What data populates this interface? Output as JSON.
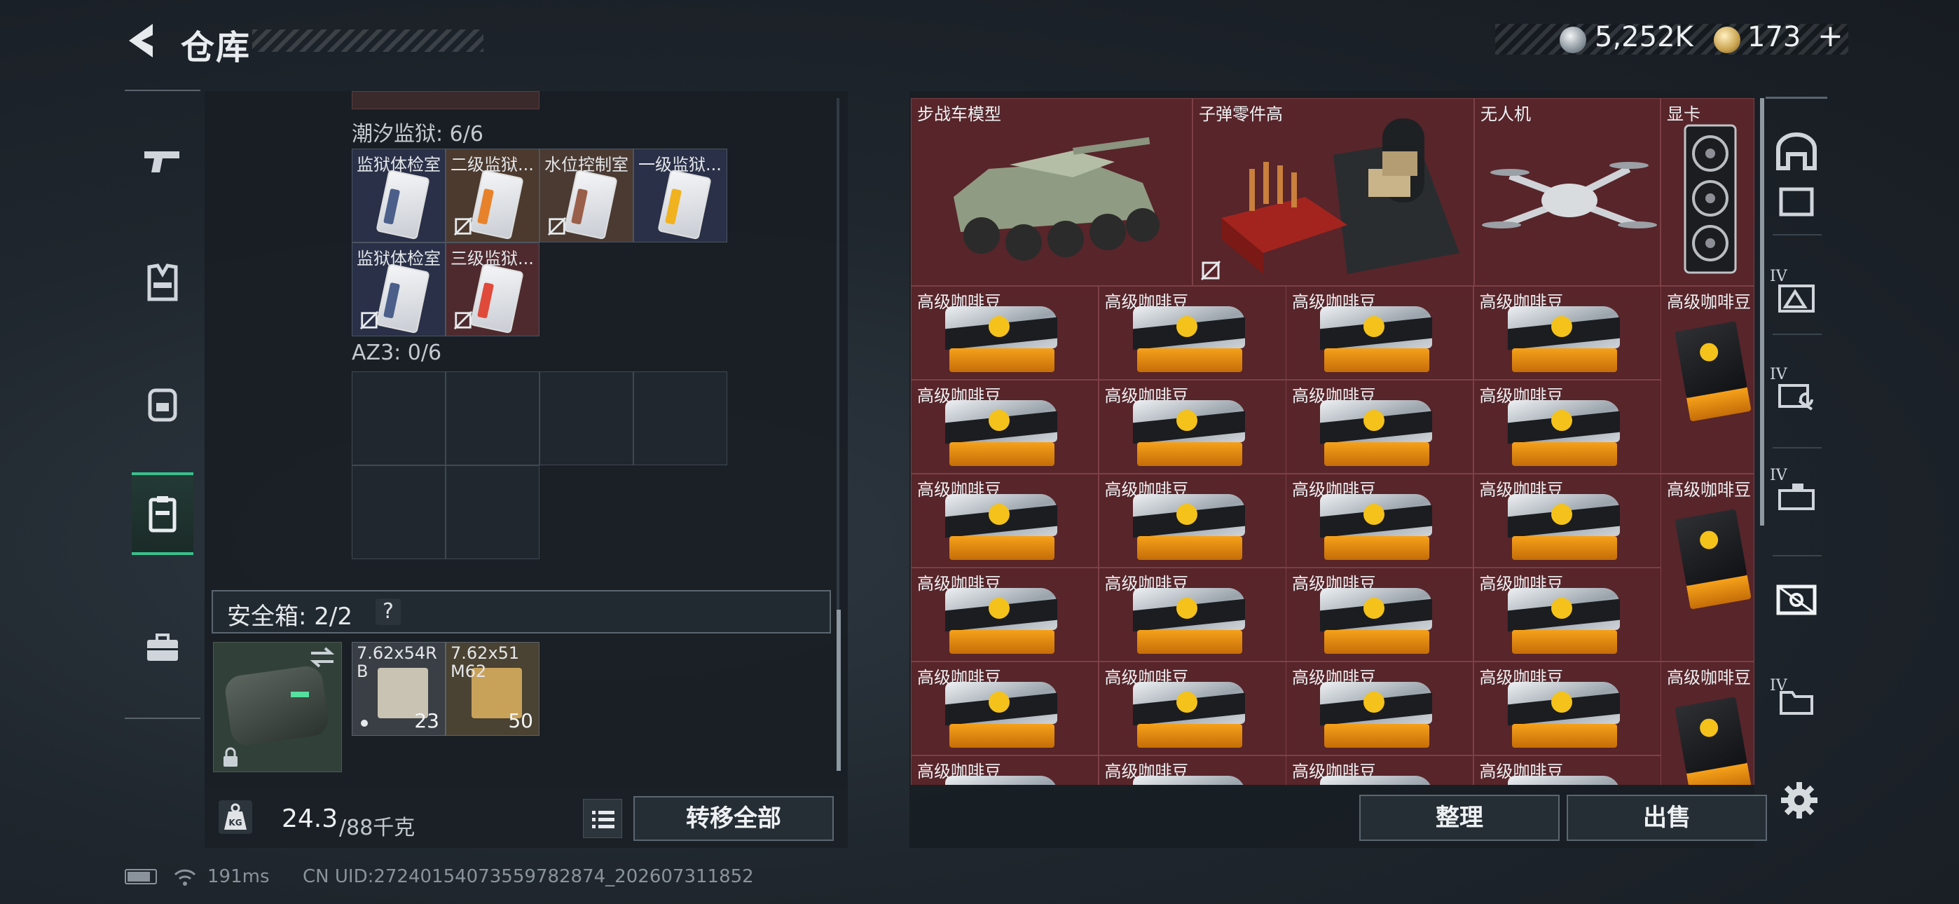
{
  "header": {
    "title": "仓库",
    "currency_silver": "5,252K",
    "currency_gold": "173",
    "currency_plus": "+"
  },
  "left_rail": {
    "items": [
      {
        "name": "weapons",
        "icon": "pistol-icon"
      },
      {
        "name": "armor",
        "icon": "vest-icon"
      },
      {
        "name": "backpack",
        "icon": "backpack-icon"
      },
      {
        "name": "containers",
        "icon": "clipboard-icon",
        "active": true
      },
      {
        "name": "cases",
        "icon": "briefcase-icon"
      }
    ]
  },
  "inventory": {
    "section_tide": "潮汐监狱: 6/6",
    "tide_slots": [
      {
        "label": "监狱体检室",
        "stripe": "#4b5f8a",
        "no_carry": false,
        "bg": "#2a3048"
      },
      {
        "label": "二级监狱...",
        "stripe": "#e8822a",
        "no_carry": true,
        "bg": "#4c3a2e"
      },
      {
        "label": "水位控制室",
        "stripe": "#9a5f4a",
        "no_carry": true,
        "bg": "#4a3a32"
      },
      {
        "label": "一级监狱...",
        "stripe": "#f0b21e",
        "no_carry": false,
        "bg": "#2a3048"
      },
      {
        "label": "监狱体检室",
        "stripe": "#4b5f8a",
        "no_carry": true,
        "bg": "#2a3048"
      },
      {
        "label": "三级监狱...",
        "stripe": "#e04a3a",
        "no_carry": true,
        "bg": "#4e2a2e"
      }
    ],
    "section_az3": "AZ3: 0/6",
    "safebox_label": "安全箱: 2/2",
    "safebox_help": "?",
    "ammo": [
      {
        "label": "7.62x54R\nB",
        "count": "23",
        "box_color": "#c9c3b3",
        "bg": "#3a3f45"
      },
      {
        "label": "7.62x51\nM62",
        "count": "50",
        "box_color": "#c9a25a",
        "bg": "#4a4232"
      }
    ],
    "weight_current": "24.3",
    "weight_max": "/88千克",
    "transfer_all": "转移全部"
  },
  "warehouse": {
    "top_items": [
      {
        "label": "步战车模型"
      },
      {
        "label": "子弹零件高"
      },
      {
        "label": "无人机"
      },
      {
        "label": "显卡"
      }
    ],
    "coffee_label": "高级咖啡豆",
    "tidy": "整理",
    "sell": "出售"
  },
  "right_rail": {
    "items": [
      {
        "name": "house",
        "icon": "house-icon",
        "prefix": ""
      },
      {
        "name": "tab-2",
        "icon": "room-icon",
        "prefix": ""
      },
      {
        "name": "tab-3",
        "icon": "mountain-icon",
        "prefix": "IV"
      },
      {
        "name": "tab-4",
        "icon": "tools-icon",
        "prefix": "IV"
      },
      {
        "name": "tab-5",
        "icon": "medical-icon",
        "prefix": "IV"
      },
      {
        "name": "tab-6",
        "icon": "card-icon",
        "prefix": ""
      },
      {
        "name": "tab-7",
        "icon": "folder-icon",
        "prefix": "IV"
      }
    ]
  },
  "status": {
    "ping": "191ms",
    "uid": "CN UID:2724015407355978287​4_202607311852"
  },
  "colors": {
    "accent_green": "#38c08c",
    "cell_red": "#57252a"
  }
}
